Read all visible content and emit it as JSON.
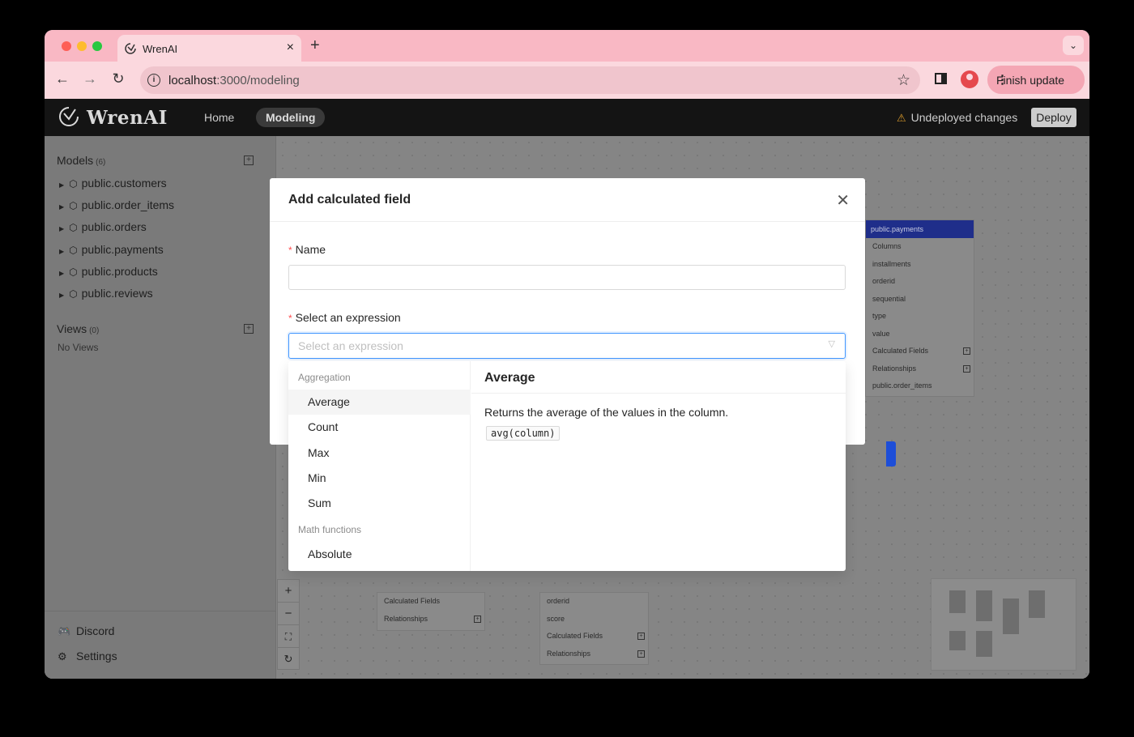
{
  "browser": {
    "tab_title": "WrenAI",
    "url_host": "localhost",
    "url_path": ":3000/modeling",
    "finish_update": "Finish update"
  },
  "header": {
    "brand": "WrenAI",
    "nav": {
      "home": "Home",
      "modeling": "Modeling"
    },
    "undeployed": "Undeployed changes",
    "deploy": "Deploy",
    "warn_color": "#d99a2b"
  },
  "sidebar": {
    "models_title": "Models",
    "models_count": "(6)",
    "models": [
      "public.customers",
      "public.order_items",
      "public.orders",
      "public.payments",
      "public.products",
      "public.reviews"
    ],
    "views_title": "Views",
    "views_count": "(0)",
    "no_views": "No Views",
    "discord": "Discord",
    "settings": "Settings"
  },
  "nodes": {
    "payments": {
      "title": "public.payments",
      "rows": [
        "Columns",
        "installments",
        "orderid",
        "sequential",
        "type",
        "value",
        "Calculated Fields",
        "Relationships",
        "public.order_items"
      ]
    },
    "left_partial": {
      "rows": [
        "Calculated Fields",
        "Relationships"
      ]
    },
    "mid_partial": {
      "rows": [
        "orderid",
        "score",
        "Calculated Fields",
        "Relationships"
      ]
    }
  },
  "modal": {
    "title": "Add calculated field",
    "name_label": "Name",
    "expr_label": "Select an expression",
    "expr_placeholder": "Select an expression",
    "accent": "#4096ff"
  },
  "dropdown": {
    "group_aggregation": "Aggregation",
    "options_aggregation": [
      "Average",
      "Count",
      "Max",
      "Min",
      "Sum"
    ],
    "group_math": "Math functions",
    "options_math": [
      "Absolute"
    ],
    "detail_title": "Average",
    "detail_desc": "Returns the average of the values in the column.",
    "detail_code": "avg(column)"
  }
}
